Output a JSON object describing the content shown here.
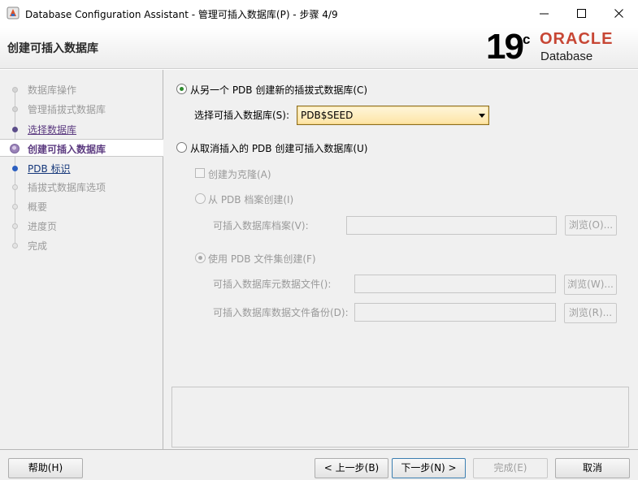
{
  "window": {
    "title": "Database Configuration Assistant - 管理可插入数据库(P) - 步骤 4/9"
  },
  "header": {
    "page_title": "创建可插入数据库",
    "logo": {
      "version": "19",
      "version_suffix": "c",
      "brand": "ORACLE",
      "product": "Database",
      "brand_color": "#c74634"
    }
  },
  "steps": [
    {
      "label": "数据库操作",
      "state": "done"
    },
    {
      "label": "管理插拔式数据库",
      "state": "done"
    },
    {
      "label": "选择数据库",
      "state": "link"
    },
    {
      "label": "创建可插入数据库",
      "state": "current"
    },
    {
      "label": "PDB 标识",
      "state": "next"
    },
    {
      "label": "插拔式数据库选项",
      "state": "future"
    },
    {
      "label": "概要",
      "state": "future"
    },
    {
      "label": "进度页",
      "state": "future"
    },
    {
      "label": "完成",
      "state": "future"
    }
  ],
  "main": {
    "option_from_pdb": {
      "label": "从另一个 PDB 创建新的插拔式数据库(C)",
      "selected": true
    },
    "select_pdb": {
      "label": "选择可插入数据库(S):",
      "value": "PDB$SEED"
    },
    "option_from_unplugged": {
      "label": "从取消插入的 PDB 创建可插入数据库(U)",
      "selected": false
    },
    "create_as_clone": {
      "label": "创建为克隆(A)",
      "checked": false
    },
    "from_pdb_archive": {
      "label": "从 PDB 档案创建(I)",
      "selected": false
    },
    "pdb_archive": {
      "label": "可插入数据库档案(V):",
      "value": "",
      "browse": "浏览(O)..."
    },
    "from_file_set": {
      "label": "使用 PDB 文件集创建(F)",
      "selected": true
    },
    "metadata_file": {
      "label": "可插入数据库元数据文件():",
      "value": "",
      "browse": "浏览(W)..."
    },
    "datafile_backup": {
      "label": "可插入数据库数据文件备份(D):",
      "value": "",
      "browse": "浏览(R)..."
    }
  },
  "footer": {
    "help": "帮助(H)",
    "back": "< 上一步(B)",
    "next": "下一步(N) >",
    "finish": "完成(E)",
    "cancel": "取消"
  }
}
